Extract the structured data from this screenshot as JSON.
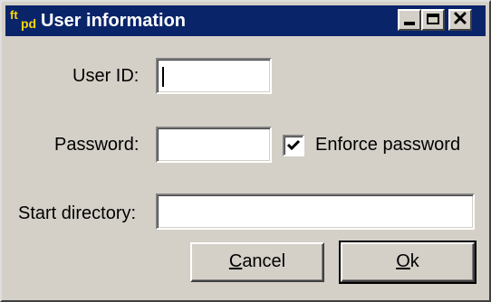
{
  "window": {
    "title": "User information",
    "icon_text_1": "ft",
    "icon_text_2": "pd",
    "minimize_label": "Minimize",
    "maximize_label": "Maximize",
    "close_label": "Close"
  },
  "form": {
    "user_id": {
      "label": "User ID:",
      "value": ""
    },
    "password": {
      "label": "Password:",
      "value": ""
    },
    "enforce_password": {
      "label": "Enforce password",
      "checked": true
    },
    "start_directory": {
      "label": "Start directory:",
      "value": ""
    }
  },
  "buttons": {
    "cancel": {
      "accel": "C",
      "rest": "ancel"
    },
    "ok": {
      "accel": "O",
      "rest": "k"
    }
  },
  "colors": {
    "titlebar": "#0a246a",
    "face": "#d4d0c8",
    "icon": "#ffd700"
  },
  "icons": [
    "ftpd-app-icon",
    "minimize-icon",
    "maximize-icon",
    "close-icon",
    "checkmark-icon"
  ]
}
